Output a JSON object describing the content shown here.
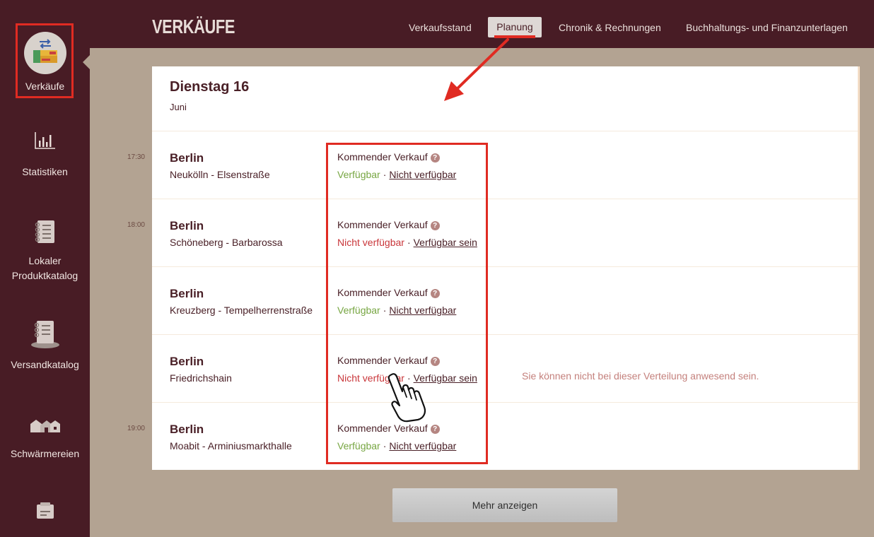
{
  "sidebar": {
    "items": [
      {
        "label": "Verkäufe",
        "icon": "sales-crate-icon",
        "active": true
      },
      {
        "label": "Statistiken",
        "icon": "bar-chart-icon"
      },
      {
        "label": "Lokaler Produktkatalog",
        "icon": "notebook-icon"
      },
      {
        "label": "Versandkatalog",
        "icon": "shipping-catalog-icon"
      },
      {
        "label": "Schwärmereien",
        "icon": "farmhouses-icon"
      },
      {
        "label": "",
        "icon": "folder-icon"
      }
    ]
  },
  "header": {
    "brand": "VERKÄUFE",
    "nav": [
      {
        "label": "Verkaufsstand"
      },
      {
        "label": "Planung",
        "active": true
      },
      {
        "label": "Chronik & Rechnungen"
      },
      {
        "label": "Buchhaltungs- und Finanzunterlagen"
      }
    ]
  },
  "planning": {
    "day": "Dienstag 16",
    "month": "Juni",
    "status_title": "Kommender Verkauf",
    "help_glyph": "?",
    "separator": "·",
    "rows": [
      {
        "time": "17:30",
        "city": "Berlin",
        "place": "Neukölln - Elsenstraße",
        "state": "Verfügbar",
        "action": "Nicht verfügbar",
        "state_type": "available"
      },
      {
        "time": "18:00",
        "city": "Berlin",
        "place": "Schöneberg - Barbarossa",
        "state": "Nicht verfügbar",
        "action": "Verfügbar sein",
        "state_type": "unavailable"
      },
      {
        "time": "",
        "city": "Berlin",
        "place": "Kreuzberg - Tempelherrenstraße",
        "state": "Verfügbar",
        "action": "Nicht verfügbar",
        "state_type": "available"
      },
      {
        "time": "",
        "city": "Berlin",
        "place": "Friedrichshain",
        "state": "Nicht verfügbar",
        "action": "Verfügbar sein",
        "state_type": "unavailable",
        "note": "Sie können nicht bei dieser Verteilung anwesend sein."
      },
      {
        "time": "19:00",
        "city": "Berlin",
        "place": "Moabit - Arminiusmarkthalle",
        "state": "Verfügbar",
        "action": "Nicht verfügbar",
        "state_type": "available"
      }
    ],
    "more_label": "Mehr anzeigen"
  },
  "colors": {
    "sidebar_bg": "#481c25",
    "page_bg": "#b3a392",
    "accent_red": "#e02b22",
    "available": "#77a642",
    "unavailable": "#c9363a"
  }
}
